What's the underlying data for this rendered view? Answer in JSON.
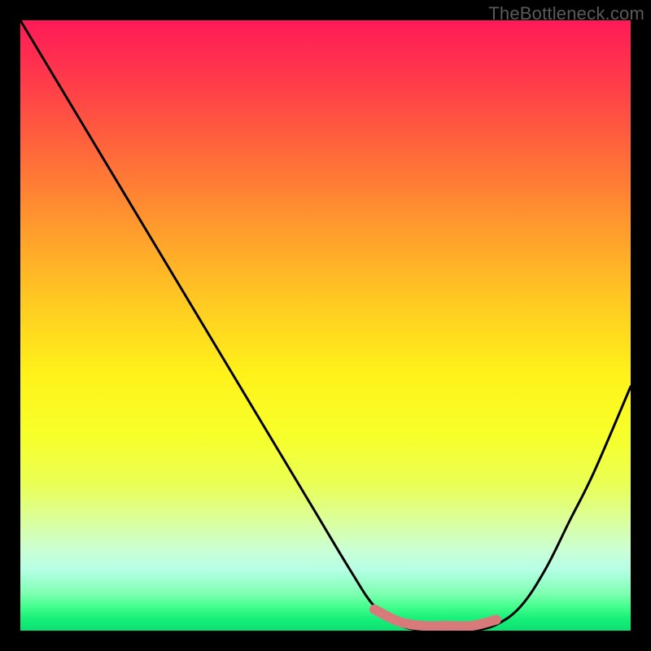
{
  "watermark": "TheBottleneck.com",
  "chart_data": {
    "type": "line",
    "title": "",
    "xlabel": "",
    "ylabel": "",
    "xlim": [
      0,
      100
    ],
    "ylim": [
      0,
      100
    ],
    "grid": false,
    "series": [
      {
        "name": "bottleneck-curve",
        "color": "#000000",
        "stroke_width": 3,
        "x": [
          0,
          6,
          12,
          18,
          24,
          30,
          36,
          42,
          48,
          54,
          58,
          62,
          66,
          70,
          74,
          78,
          82,
          86,
          90,
          94,
          100
        ],
        "values": [
          100,
          90,
          80,
          70,
          60,
          50,
          40,
          30,
          20,
          10,
          4,
          1,
          0,
          0,
          0,
          1,
          4,
          10,
          18,
          26,
          40
        ]
      },
      {
        "name": "optimal-band",
        "color": "#d97a7a",
        "stroke_width": 12,
        "x": [
          58,
          62,
          66,
          70,
          74,
          78
        ],
        "values": [
          3.5,
          1.5,
          0.8,
          0.8,
          0.8,
          1.8
        ]
      }
    ],
    "background_gradient": {
      "top": "#ff1a58",
      "middle": "#fff21a",
      "bottom": "#0be070"
    }
  }
}
